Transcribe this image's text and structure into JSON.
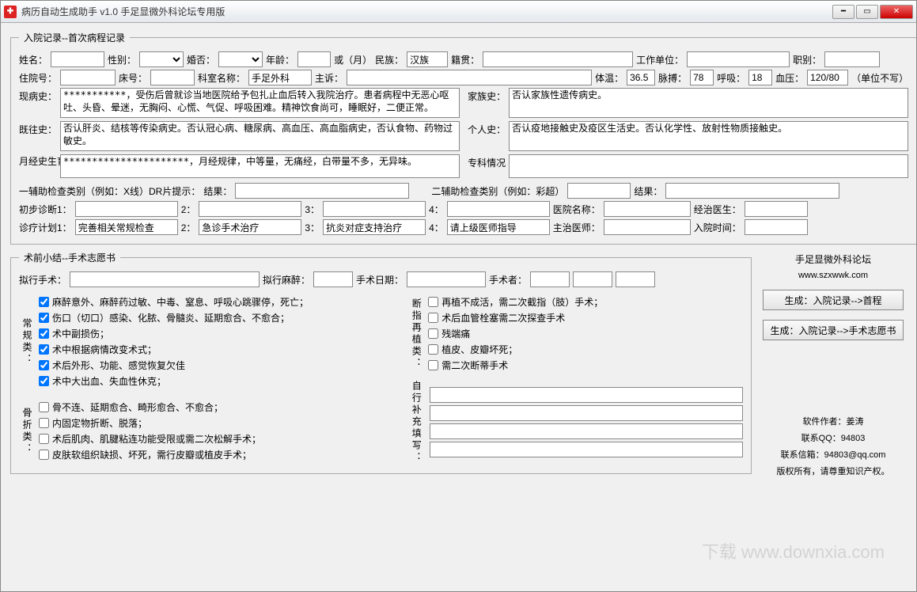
{
  "title": "病历自动生成助手 v1.0 手足显微外科论坛专用版",
  "section1": {
    "legend": "入院记录--首次病程记录",
    "labels": {
      "name": "姓名：",
      "sex": "性别：",
      "marry": "婚否：",
      "age": "年龄：",
      "or_month": "或（月）",
      "ethnic": "民族：",
      "native": "籍贯：",
      "work": "工作单位：",
      "job": "职别：",
      "admit_no": "住院号：",
      "bed": "床号：",
      "dept": "科室名称：",
      "chief": "主诉：",
      "temp": "体温：",
      "pulse": "脉搏：",
      "breath": "呼吸：",
      "bp": "血压：",
      "bp_unit": "（单位不写）",
      "present": "现病史：",
      "family": "家族史：",
      "past": "既往史：",
      "personal": "个人史：",
      "menses": "月经史生育史",
      "special": "专科情况",
      "aux1": "一辅助检查类别（例如：X线）DR片提示：",
      "result1": "结果：",
      "aux2": "二辅助检查类别（例如：彩超）",
      "result2": "结果：",
      "diag1": "初步诊断1：",
      "n2": "2：",
      "n3": "3：",
      "n4": "4：",
      "hospital": "医院名称：",
      "doctor1": "经治医生：",
      "plan1": "诊疗计划1：",
      "doctor2": "主治医师：",
      "admit_time": "入院时间："
    },
    "values": {
      "ethnic": "汉族",
      "dept": "手足外科",
      "temp": "36.5",
      "pulse": "78",
      "breath": "18",
      "bp": "120/80",
      "present": "***********，受伤后曾就诊当地医院给予包扎止血后转入我院治疗。患者病程中无恶心呕吐、头昏、晕迷，无胸闷、心慌、气促、呼吸困难。精神饮食尚可，睡眠好，二便正常。",
      "family": "否认家族性遗传病史。",
      "past": "否认肝炎、结核等传染病史。否认冠心病、糖尿病、高血压、高血脂病史，否认食物、药物过敏史。",
      "personal": "否认疫地接触史及疫区生活史。否认化学性、放射性物质接触史。",
      "menses": "**********************，月经规律，中等量，无痛经，白带量不多，无异味。",
      "plan1": "完善相关常规检查",
      "plan2": "急诊手术治疗",
      "plan3": "抗炎对症支持治疗",
      "plan4": "请上级医师指导"
    }
  },
  "section2": {
    "legend": "术前小结--手术志愿书",
    "labels": {
      "op": "拟行手术：",
      "anes": "拟行麻醉：",
      "date": "手术日期：",
      "surgeon": "手术者："
    },
    "groups": {
      "g1_title": "常规类：",
      "g1": [
        "麻醉意外、麻醉药过敏、中毒、窒息、呼吸心跳骤停，死亡；",
        "伤口（切口）感染、化脓、骨髓炎、延期愈合、不愈合；",
        "术中副损伤；",
        "术中根据病情改变术式；",
        "术后外形、功能、感觉恢复欠佳",
        "术中大出血、失血性休克；"
      ],
      "g2_title": "断指再植类：",
      "g2": [
        "再植不成活，需二次截指（肢）手术；",
        "术后血管栓塞需二次探查手术",
        "残端痛",
        "植皮、皮瓣坏死；",
        "需二次断蒂手术"
      ],
      "g3_title": "骨折类：",
      "g3": [
        "骨不连、延期愈合、畸形愈合、不愈合；",
        "内固定物折断、脱落；",
        "术后肌肉、肌腱粘连功能受限或需二次松解手术；",
        "皮肤软组织缺损、坏死，需行皮瓣或植皮手术；"
      ],
      "g4_title": "自行补充填写："
    }
  },
  "side": {
    "title": "手足显微外科论坛",
    "url": "www.szxwwk.com",
    "btn1": "生成：入院记录-->首程",
    "btn2": "生成：入院记录-->手术志愿书",
    "author": "软件作者：姜涛",
    "qq": "联系QQ：94803",
    "email": "联系信箱：94803@qq.com",
    "copyright": "版权所有，请尊重知识产权。"
  },
  "watermark": "下载 www.downxia.com"
}
